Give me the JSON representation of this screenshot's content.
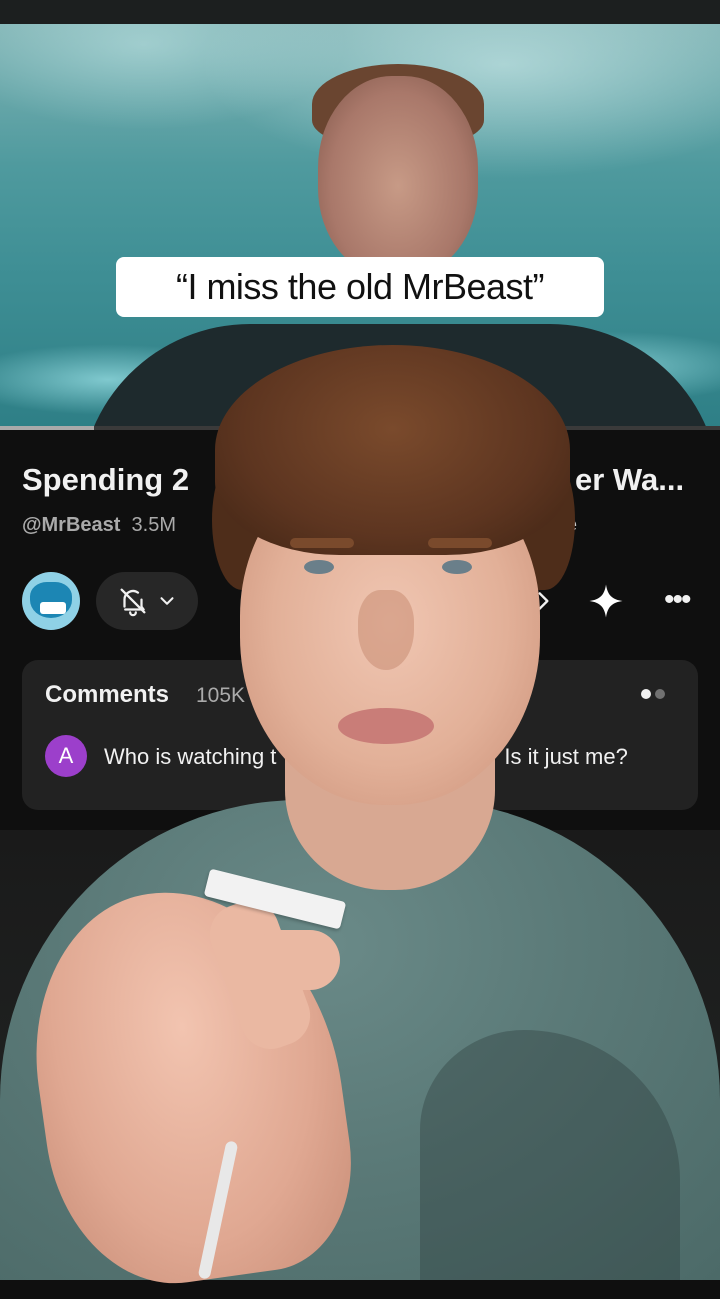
{
  "video": {
    "caption": "“I miss the old MrBeast”",
    "progress_fraction": 0.13
  },
  "youtube": {
    "title_start": "Spending 2",
    "title_end": "er Wa...",
    "channel_handle": "@MrBeast",
    "subscribers": "3.5M",
    "meta_end": "re",
    "channel_avatar_icon": "mrbeast-logo-icon",
    "subscribe_bell_icon": "bell-off-icon",
    "comments": {
      "label": "Comments",
      "count": "105K",
      "avatar_initial": "A",
      "comment_start": "Who is watching t",
      "comment_end": "? Is it just me?"
    }
  },
  "colors": {
    "background": "#0f0f0f",
    "card": "#222222",
    "comment_avatar": "#9c3fcb",
    "water": "#4f9a9e"
  }
}
